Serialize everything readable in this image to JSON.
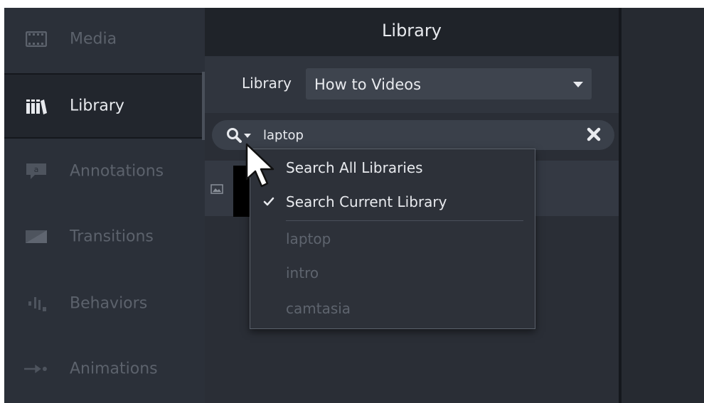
{
  "sidebar": {
    "items": [
      {
        "label": "Media",
        "icon": "film-icon",
        "active": false
      },
      {
        "label": "Library",
        "icon": "books-icon",
        "active": true
      },
      {
        "label": "Annotations",
        "icon": "speech-bubble-icon",
        "active": false
      },
      {
        "label": "Transitions",
        "icon": "transition-icon",
        "active": false
      },
      {
        "label": "Behaviors",
        "icon": "behaviors-icon",
        "active": false
      },
      {
        "label": "Animations",
        "icon": "animation-arrow-icon",
        "active": false
      }
    ]
  },
  "panel": {
    "title": "Library",
    "library_label": "Library",
    "library_select_value": "How to Videos"
  },
  "search": {
    "query": "laptop"
  },
  "search_menu": {
    "options": [
      {
        "label": "Search All Libraries",
        "checked": false
      },
      {
        "label": "Search Current Library",
        "checked": true
      }
    ],
    "recent": [
      "laptop",
      "intro",
      "camtasia"
    ]
  },
  "colors": {
    "background": "#2a2e36",
    "sidebar": "#2b3039",
    "text": "#e8eaee",
    "muted": "#5c626c"
  }
}
